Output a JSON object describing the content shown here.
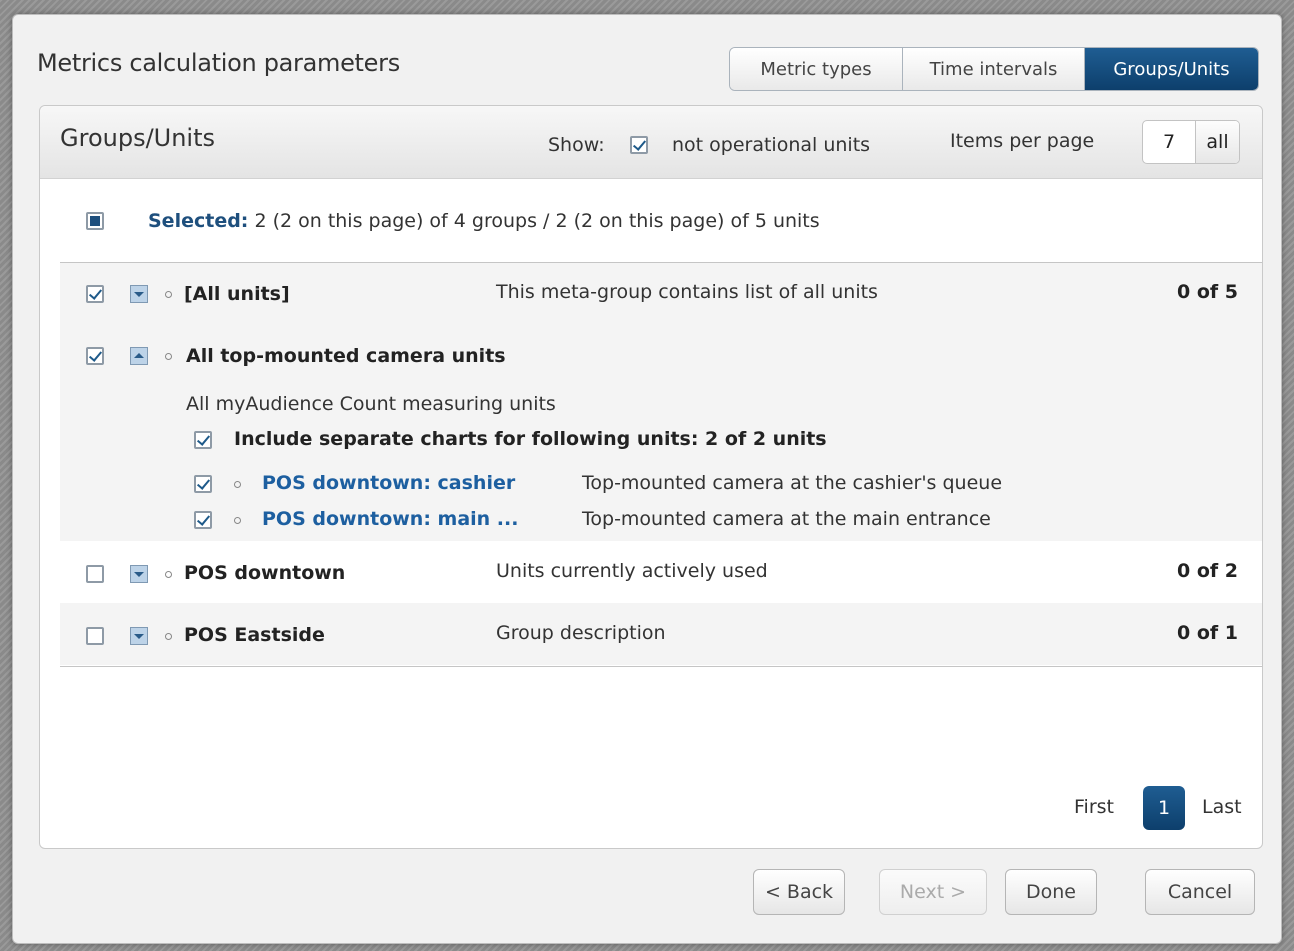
{
  "dialog": {
    "title": "Metrics calculation parameters",
    "steps": [
      "Metric types",
      "Time intervals",
      "Groups/Units"
    ],
    "active_step": "Groups/Units"
  },
  "panel": {
    "title": "Groups/Units",
    "show_label": "Show:",
    "show_option": "not operational units",
    "show_checked": true,
    "items_per_page_label": "Items per page",
    "items_per_page_value": "7",
    "items_per_page_all": "all",
    "selected_label": "Selected:",
    "selected_text": " 2 (2 on this page) of 4 groups / 2 (2 on this page) of 5 units"
  },
  "groups": [
    {
      "name": "[All units]",
      "desc": "This meta-group contains list of all units",
      "count": "0 of 5",
      "checked": true
    },
    {
      "name": "All top-mounted camera units",
      "checked": true,
      "expanded": true,
      "desc": "All myAudience Count measuring units",
      "include_text": "Include separate charts for following units: 2 of 2 units",
      "units": [
        {
          "name": "POS downtown: cashier",
          "desc": "Top-mounted camera at the cashier's queue",
          "checked": true
        },
        {
          "name": "POS downtown: main ...",
          "desc": "Top-mounted camera at the main entrance",
          "checked": true
        }
      ]
    },
    {
      "name": "POS downtown",
      "desc": "Units currently actively used",
      "count": "0 of 2",
      "checked": false
    },
    {
      "name": "POS Eastside",
      "desc": "Group description",
      "count": "0 of 1",
      "checked": false
    }
  ],
  "pager": {
    "first": "First",
    "current": "1",
    "last": "Last"
  },
  "buttons": {
    "back": "< Back",
    "next": "Next >",
    "done": "Done",
    "cancel": "Cancel"
  }
}
